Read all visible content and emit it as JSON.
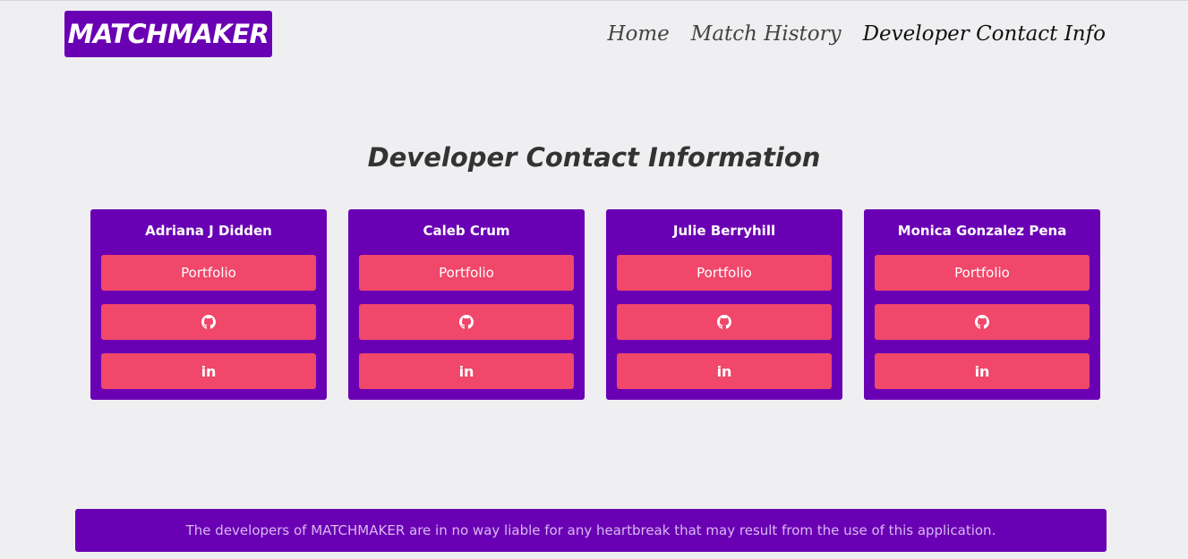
{
  "brand": {
    "logo_text": "MATCHMAKER",
    "color": "#6a00b4"
  },
  "nav": {
    "items": [
      {
        "label": "Home",
        "active": false
      },
      {
        "label": "Match History",
        "active": false
      },
      {
        "label": "Developer Contact Info",
        "active": true
      }
    ]
  },
  "page_title": "Developer Contact Information",
  "buttons": {
    "portfolio_label": "Portfolio",
    "github_icon": "github-icon",
    "linkedin_icon": "linkedin-icon",
    "color": "#f0476a"
  },
  "developers": [
    {
      "name": "Adriana J Didden"
    },
    {
      "name": "Caleb Crum"
    },
    {
      "name": "Julie Berryhill"
    },
    {
      "name": "Monica Gonzalez Pena"
    }
  ],
  "footer": {
    "text": "The developers of MATCHMAKER are in no way liable for any heartbreak that may result from the use of this application."
  }
}
